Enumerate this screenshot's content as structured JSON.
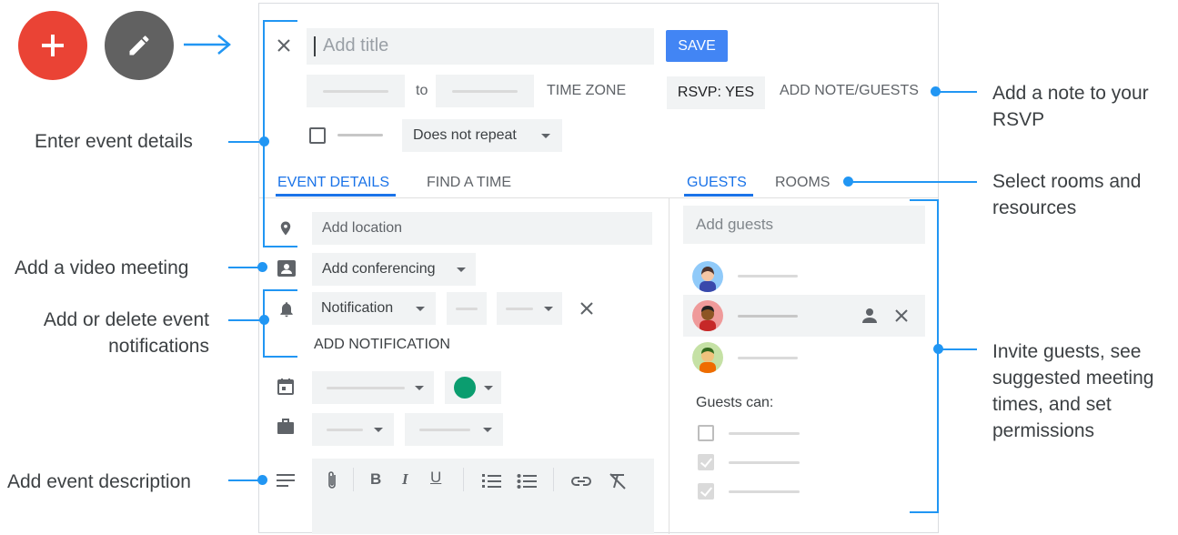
{
  "fabs": {
    "add_icon": "plus-icon",
    "edit_icon": "pencil-icon"
  },
  "header": {
    "title_placeholder": "Add title",
    "save_label": "SAVE",
    "to_label": "to",
    "time_zone_label": "TIME ZONE",
    "rsvp_label": "RSVP: YES",
    "add_note_label": "ADD NOTE/GUESTS",
    "repeat_label": "Does not repeat"
  },
  "tabs": {
    "left": [
      {
        "label": "EVENT DETAILS",
        "active": true
      },
      {
        "label": "FIND A TIME",
        "active": false
      }
    ],
    "right": [
      {
        "label": "GUESTS",
        "active": true
      },
      {
        "label": "ROOMS",
        "active": false
      }
    ]
  },
  "details": {
    "location_placeholder": "Add location",
    "conferencing_label": "Add conferencing",
    "notification_label": "Notification",
    "add_notification_label": "ADD NOTIFICATION"
  },
  "guests": {
    "add_placeholder": "Add guests",
    "guests_can_label": "Guests can:",
    "permissions_checked": [
      false,
      true,
      true
    ]
  },
  "callouts": {
    "enter_details": "Enter event details",
    "video_meeting": "Add a video meeting",
    "notifications_line1": "Add or delete event",
    "notifications_line2": "notifications",
    "description": "Add event description",
    "rsvp_note_line1": "Add a note to your",
    "rsvp_note_line2": "RSVP",
    "rooms_line1": "Select rooms and",
    "rooms_line2": "resources",
    "invite_line1": "Invite guests, see",
    "invite_line2": "suggested meeting",
    "invite_line3": "times, and set",
    "invite_line4": "permissions"
  },
  "colors": {
    "accent": "#1a73e8",
    "annotation_blue": "#2196f3",
    "fab_add": "#ea4335",
    "fab_edit": "#616161",
    "event_color": "#0b9d6f"
  }
}
